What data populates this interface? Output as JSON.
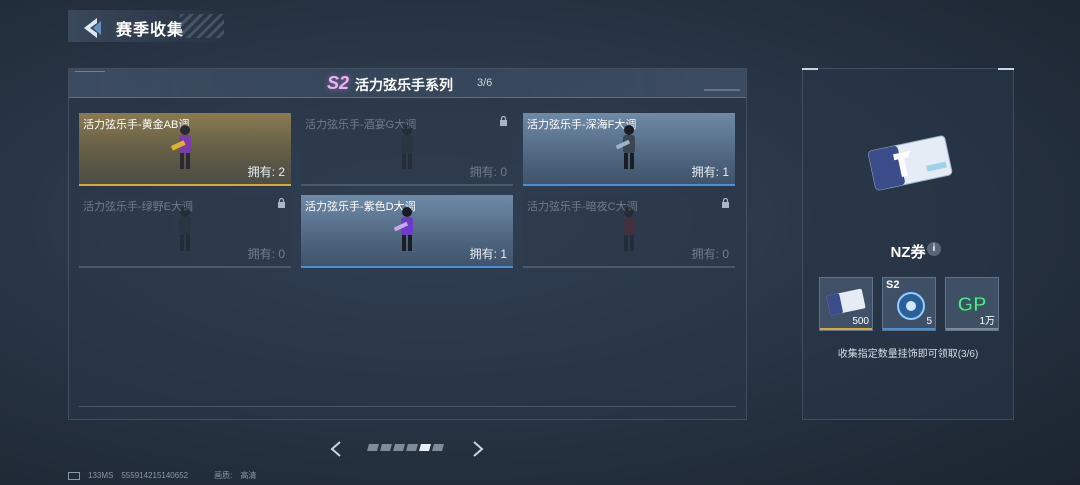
{
  "header": {
    "title": "赛季收集"
  },
  "series": {
    "badge": "S2",
    "name": "活力弦乐手系列",
    "count": "3/6"
  },
  "cards": [
    {
      "name": "活力弦乐手-黄金AB调",
      "owned": "拥有: 2",
      "state": "gold"
    },
    {
      "name": "活力弦乐手-酒宴G大调",
      "owned": "拥有: 0",
      "state": "locked"
    },
    {
      "name": "活力弦乐手-深海F大调",
      "owned": "拥有: 1",
      "state": "blue"
    },
    {
      "name": "活力弦乐手-绿野E大调",
      "owned": "拥有: 0",
      "state": "locked"
    },
    {
      "name": "活力弦乐手-紫色D大调",
      "owned": "拥有: 1",
      "state": "blue"
    },
    {
      "name": "活力弦乐手-暗夜C大调",
      "owned": "拥有: 0",
      "state": "locked"
    }
  ],
  "pager": {
    "total": 6,
    "active_index": 4
  },
  "side": {
    "reward_title": "NZ券",
    "info_icon": "i",
    "rewards": [
      {
        "icon": "ticket-icon",
        "qty": "500",
        "accent": "#d8a83a"
      },
      {
        "icon": "s2-gear-icon",
        "tag": "S2",
        "qty": "5",
        "accent": "#4a8fd8"
      },
      {
        "icon": "gp-icon",
        "label": "GP",
        "qty": "1万",
        "accent": "#7e8b9a"
      }
    ],
    "description": "收集指定数量挂饰即可领取(3/6)"
  },
  "footer": {
    "ping": "133MS",
    "uid": "555914215140652",
    "quality_label": "画质:",
    "quality_value": "高清"
  },
  "colors": {
    "gold": "#d8a83a",
    "blue": "#4a8fd8",
    "badge": "#e9b6ef"
  }
}
